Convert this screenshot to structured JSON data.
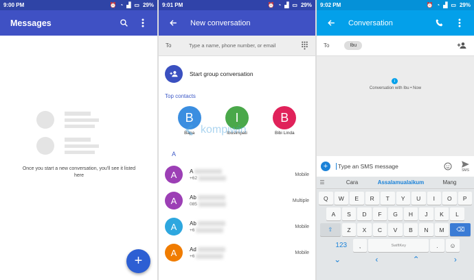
{
  "panel1": {
    "status": {
      "time": "9:00 PM",
      "battery": "29%"
    },
    "title": "Messages",
    "empty_text": "Once you start a new conversation, you'll see it listed here",
    "fab_label": "+"
  },
  "panel2": {
    "status": {
      "time": "9:01 PM",
      "battery": "29%"
    },
    "title": "New conversation",
    "to_label": "To",
    "to_placeholder": "Type a name, phone number, or email",
    "group_label": "Start group conversation",
    "top_contacts_label": "Top contacts",
    "top_contacts": [
      {
        "initial": "B",
        "name": "Bapa",
        "color": "#3b8ee0"
      },
      {
        "initial": "I",
        "name": "Ibusimpati",
        "color": "#4aa84a"
      },
      {
        "initial": "B",
        "name": "Bibi Linda",
        "color": "#e0225a"
      }
    ],
    "letter_header": "A",
    "contacts": [
      {
        "initial": "A",
        "name": "A",
        "number": "+62",
        "type": "Mobile",
        "color": "#9c3fb5"
      },
      {
        "initial": "A",
        "name": "Ab",
        "number": "085",
        "type": "Multiple",
        "color": "#9c3fb5"
      },
      {
        "initial": "A",
        "name": "Ab",
        "number": "+6",
        "type": "Mobile",
        "color": "#2ea7df"
      },
      {
        "initial": "A",
        "name": "Ad",
        "number": "+6",
        "type": "Mobile",
        "color": "#f07c00"
      }
    ],
    "watermark": "kompiwin"
  },
  "panel3": {
    "status": {
      "time": "9:02 PM",
      "battery": "29%"
    },
    "title": "Conversation",
    "to_label": "To",
    "recipient_chip": "Ibu",
    "thread_meta": "Conversation with Ibu • Now",
    "compose_placeholder": "Type an SMS message",
    "send_label": "SMS",
    "suggestions": [
      "Cara",
      "Assalamualaikum",
      "Mang"
    ],
    "keyboard": {
      "row1": [
        "Q",
        "W",
        "E",
        "R",
        "T",
        "Y",
        "U",
        "I",
        "O",
        "P"
      ],
      "row2": [
        "A",
        "S",
        "D",
        "F",
        "G",
        "H",
        "J",
        "K",
        "L"
      ],
      "row3": [
        "Z",
        "X",
        "C",
        "V",
        "B",
        "N",
        "M"
      ],
      "num_key": "123",
      "comma": ",",
      "space": "SwiftKey",
      "period": "."
    }
  },
  "colors": {
    "indigo": "#3f51c4",
    "lightblue": "#03a0ea"
  }
}
